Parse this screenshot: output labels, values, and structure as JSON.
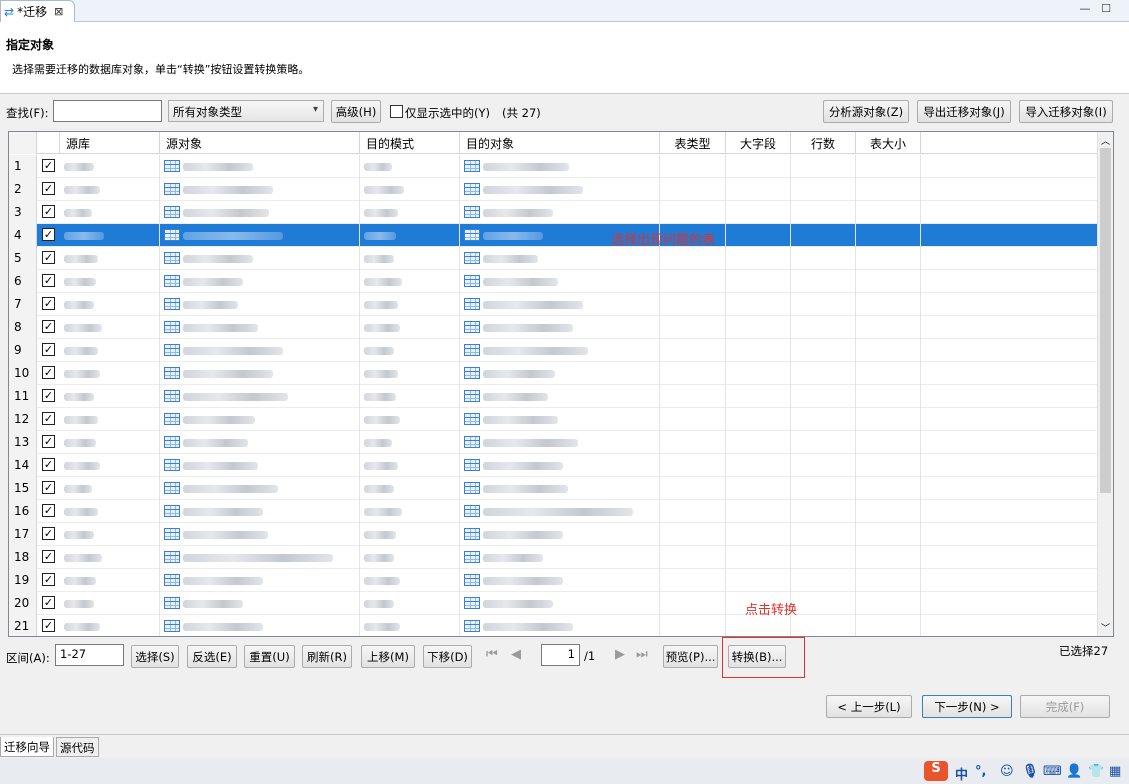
{
  "tab": {
    "title": "*迁移",
    "close": "⊠"
  },
  "window": {
    "minimize": "—",
    "maximize": "☐"
  },
  "header": {
    "title": "指定对象",
    "description": "选择需要迁移的数据库对象，单击“转换”按钮设置转换策略。"
  },
  "filter": {
    "find_label": "查找(F):",
    "find_value": "",
    "type_select": "所有对象类型",
    "advanced": "高级(H)",
    "only_selected": "仅显示选中的(Y)",
    "total": "(共 27)",
    "analyze": "分析源对象(Z)",
    "export": "导出迁移对象(J)",
    "import": "导入迁移对象(I)"
  },
  "grid": {
    "columns": [
      "源库",
      "源对象",
      "目的模式",
      "目的对象",
      "表类型",
      "大字段",
      "行数",
      "表大小"
    ],
    "rows": [
      {
        "num": "1",
        "checked": true
      },
      {
        "num": "2",
        "checked": true
      },
      {
        "num": "3",
        "checked": true
      },
      {
        "num": "4",
        "checked": true,
        "selected": true
      },
      {
        "num": "5",
        "checked": true
      },
      {
        "num": "6",
        "checked": true
      },
      {
        "num": "7",
        "checked": true
      },
      {
        "num": "8",
        "checked": true
      },
      {
        "num": "9",
        "checked": true
      },
      {
        "num": "10",
        "checked": true
      },
      {
        "num": "11",
        "checked": true
      },
      {
        "num": "12",
        "checked": true
      },
      {
        "num": "13",
        "checked": true
      },
      {
        "num": "14",
        "checked": true
      },
      {
        "num": "15",
        "checked": true
      },
      {
        "num": "16",
        "checked": true
      },
      {
        "num": "17",
        "checked": true
      },
      {
        "num": "18",
        "checked": true
      },
      {
        "num": "19",
        "checked": true
      },
      {
        "num": "20",
        "checked": true
      },
      {
        "num": "21",
        "checked": true
      }
    ],
    "annotation_row": "选择出现问题的表"
  },
  "actions": {
    "range_label": "区间(A):",
    "range_value": "1-27",
    "select": "选择(S)",
    "invert": "反选(E)",
    "reset": "重置(U)",
    "refresh": "刷新(R)",
    "up": "上移(M)",
    "down": "下移(D)",
    "page_value": "1",
    "page_total": "/1",
    "preview": "预览(P)...",
    "convert": "转换(B)...",
    "selected_count": "已选择27",
    "convert_hint": "点击转换"
  },
  "wizard": {
    "prev": "< 上一步(L)",
    "next": "下一步(N) >",
    "finish": "完成(F)"
  },
  "bottom_tabs": [
    "迁移向导",
    "源代码"
  ],
  "ime": {
    "logo": "S",
    "text": "中"
  }
}
